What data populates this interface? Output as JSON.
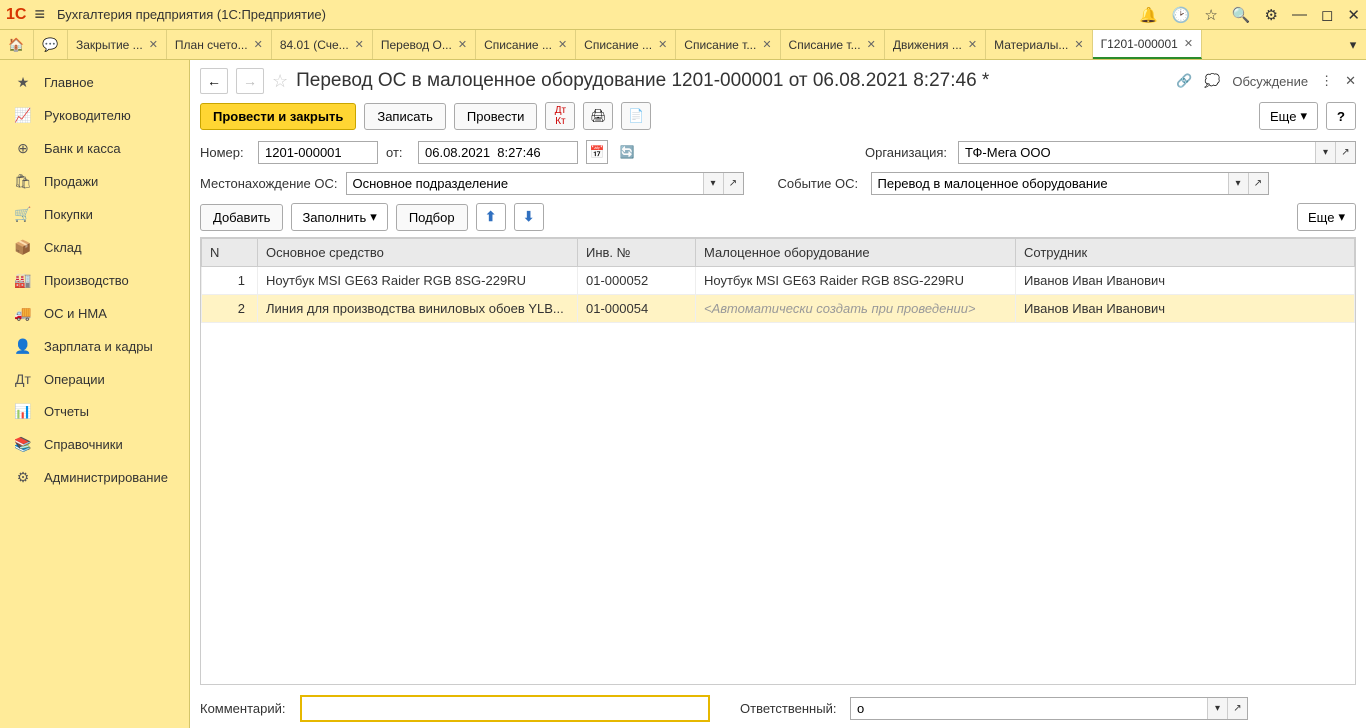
{
  "app": {
    "title": "Бухгалтерия предприятия  (1С:Предприятие)",
    "logo": "1C"
  },
  "tabs": [
    {
      "label": "Закрытие ..."
    },
    {
      "label": "План счето..."
    },
    {
      "label": "84.01 (Сче..."
    },
    {
      "label": "Перевод О..."
    },
    {
      "label": "Списание ..."
    },
    {
      "label": "Списание ..."
    },
    {
      "label": "Списание т..."
    },
    {
      "label": "Списание т..."
    },
    {
      "label": "Движения ..."
    },
    {
      "label": "Материалы..."
    },
    {
      "label": "Г1201-000001",
      "active": true
    }
  ],
  "sidebar": [
    {
      "icon": "★",
      "label": "Главное"
    },
    {
      "icon": "📈",
      "label": "Руководителю"
    },
    {
      "icon": "⊕",
      "label": "Банк и касса"
    },
    {
      "icon": "🛍",
      "label": "Продажи"
    },
    {
      "icon": "🛒",
      "label": "Покупки"
    },
    {
      "icon": "📦",
      "label": "Склад"
    },
    {
      "icon": "🏭",
      "label": "Производство"
    },
    {
      "icon": "🚚",
      "label": "ОС и НМА"
    },
    {
      "icon": "👤",
      "label": "Зарплата и кадры"
    },
    {
      "icon": "Дт",
      "label": "Операции"
    },
    {
      "icon": "📊",
      "label": "Отчеты"
    },
    {
      "icon": "📚",
      "label": "Справочники"
    },
    {
      "icon": "⚙",
      "label": "Администрирование"
    }
  ],
  "doc": {
    "title": "Перевод ОС в малоценное оборудование 1201-000001 от 06.08.2021 8:27:46 *",
    "discuss": "Обсуждение",
    "toolbar": {
      "post_close": "Провести и закрыть",
      "save": "Записать",
      "post": "Провести",
      "more": "Еще",
      "help": "?"
    },
    "form": {
      "number_label": "Номер:",
      "number": "1201-000001",
      "from_label": "от:",
      "date": "06.08.2021  8:27:46",
      "org_label": "Организация:",
      "org": "ТФ-Мега ООО",
      "loc_label": "Местонахождение ОС:",
      "loc": "Основное подразделение",
      "event_label": "Событие ОС:",
      "event": "Перевод в малоценное оборудование"
    },
    "tbl_toolbar": {
      "add": "Добавить",
      "fill": "Заполнить",
      "select": "Подбор",
      "more": "Еще"
    },
    "columns": {
      "n": "N",
      "os": "Основное средство",
      "inv": "Инв. №",
      "mc": "Малоценное оборудование",
      "emp": "Сотрудник"
    },
    "rows": [
      {
        "n": "1",
        "os": "Ноутбук MSI GE63 Raider RGB 8SG-229RU",
        "inv": "01-000052",
        "mc": "Ноутбук MSI GE63 Raider RGB 8SG-229RU",
        "emp": "Иванов Иван Иванович"
      },
      {
        "n": "2",
        "os": "Линия для производства виниловых обоев YLB...",
        "inv": "01-000054",
        "mc": "<Автоматически создать при проведении>",
        "mc_placeholder": true,
        "emp": "Иванов Иван Иванович",
        "selected": true
      }
    ],
    "bottom": {
      "comment_label": "Комментарий:",
      "comment": "",
      "resp_label": "Ответственный:",
      "resp": "о"
    }
  }
}
